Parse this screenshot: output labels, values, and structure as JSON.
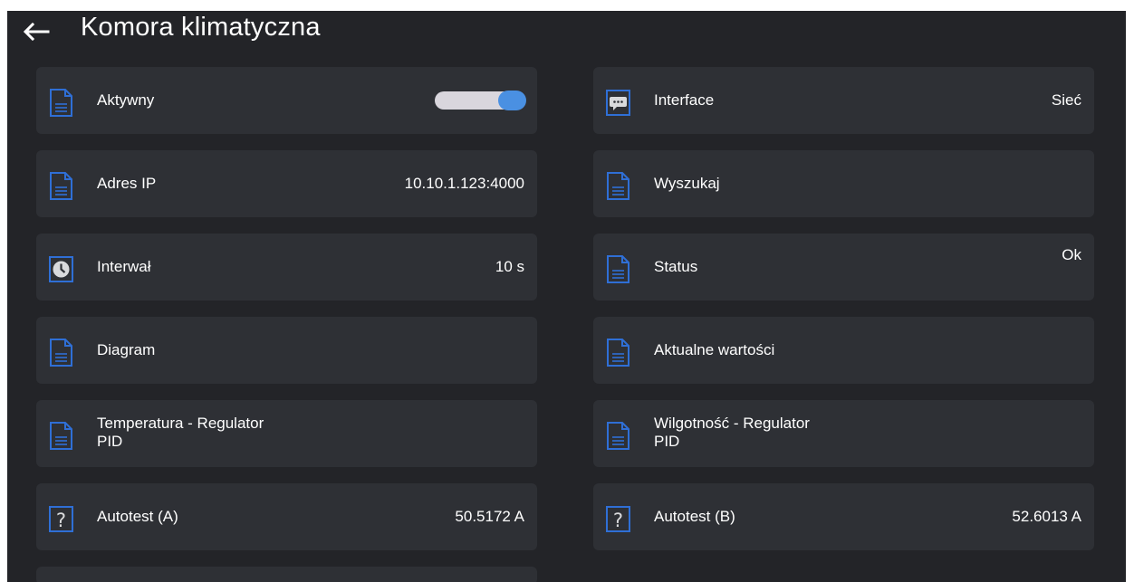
{
  "header": {
    "title": "Komora klimatyczna"
  },
  "left_column": [
    {
      "label": "Aktywny",
      "value": "",
      "icon": "document-icon",
      "toggle": true,
      "toggle_on": true
    },
    {
      "label": "Adres IP",
      "value": "10.10.1.123:4000",
      "icon": "document-icon"
    },
    {
      "label": "Interwał",
      "value": "10 s",
      "icon": "clock-icon"
    },
    {
      "label": "Diagram",
      "value": "",
      "icon": "document-icon"
    },
    {
      "label": "Temperatura - Regulator",
      "sublabel": "PID",
      "value": "",
      "icon": "document-icon"
    },
    {
      "label": "Autotest (A)",
      "value": "50.5172 A",
      "icon": "question-icon"
    }
  ],
  "right_column": [
    {
      "label": "Interface",
      "value": "Sieć",
      "icon": "chat-icon"
    },
    {
      "label": "Wyszukaj",
      "value": "",
      "icon": "document-icon"
    },
    {
      "label": "Status",
      "value": "Ok",
      "icon": "document-icon"
    },
    {
      "label": "Aktualne wartości",
      "value": "",
      "icon": "document-icon"
    },
    {
      "label": "Wilgotność - Regulator",
      "sublabel": "PID",
      "value": "",
      "icon": "document-icon"
    },
    {
      "label": "Autotest (B)",
      "value": "52.6013 A",
      "icon": "question-icon"
    }
  ],
  "colors": {
    "background": "#232428",
    "tile": "#2e3035",
    "accent": "#4a90e2",
    "icon_blue": "#2f6fd6"
  }
}
